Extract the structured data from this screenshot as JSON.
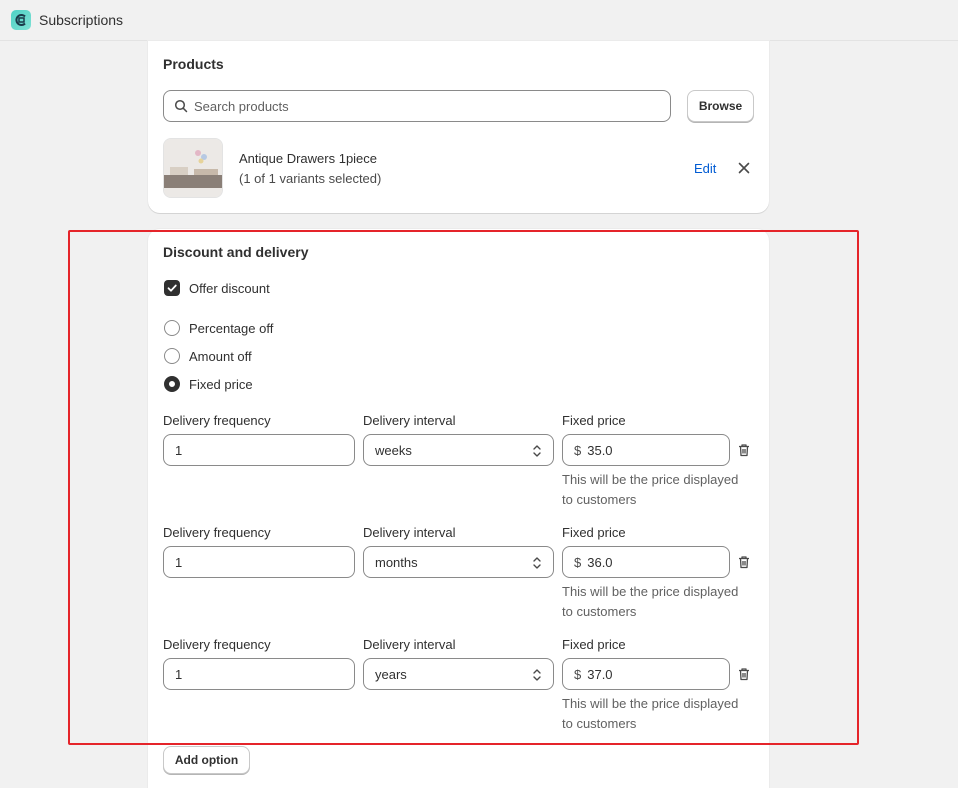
{
  "app": {
    "title": "Subscriptions",
    "icon": "app-logo-icon",
    "accent": "#4fd1c5"
  },
  "products": {
    "title": "Products",
    "search_placeholder": "Search products",
    "browse_label": "Browse",
    "item": {
      "name": "Antique Drawers 1piece",
      "variants": "(1 of 1 variants selected)",
      "edit_label": "Edit"
    }
  },
  "discount": {
    "title": "Discount and delivery",
    "offer_discount_label": "Offer discount",
    "offer_discount_checked": true,
    "options": [
      {
        "label": "Percentage off",
        "selected": false
      },
      {
        "label": "Amount off",
        "selected": false
      },
      {
        "label": "Fixed price",
        "selected": true
      }
    ],
    "rows": [
      {
        "frequency_label": "Delivery frequency",
        "frequency": "1",
        "interval_label": "Delivery interval",
        "interval": "weeks",
        "price_label": "Fixed price",
        "currency": "$",
        "price": "35.0",
        "help_line1": "This will be the price displayed",
        "help_line2": "to customers"
      },
      {
        "frequency_label": "Delivery frequency",
        "frequency": "1",
        "interval_label": "Delivery interval",
        "interval": "months",
        "price_label": "Fixed price",
        "currency": "$",
        "price": "36.0",
        "help_line1": "This will be the price displayed",
        "help_line2": "to customers"
      },
      {
        "frequency_label": "Delivery frequency",
        "frequency": "1",
        "interval_label": "Delivery interval",
        "interval": "years",
        "price_label": "Fixed price",
        "currency": "$",
        "price": "37.0",
        "help_line1": "This will be the price displayed",
        "help_line2": "to customers"
      }
    ],
    "add_option_label": "Add option"
  },
  "highlight_color": "#e5242a"
}
